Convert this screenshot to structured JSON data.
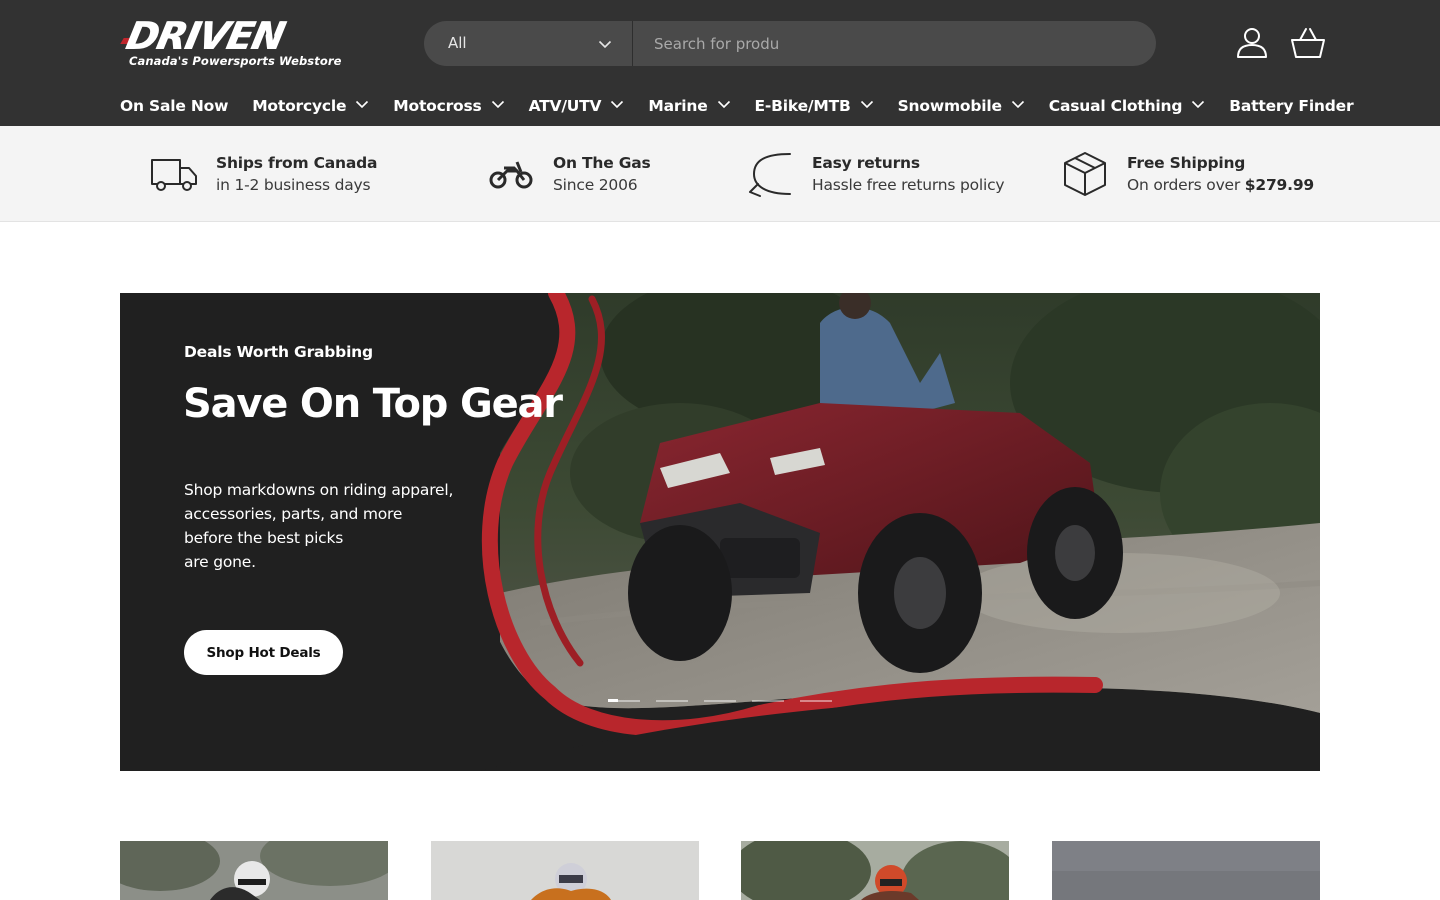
{
  "brand": {
    "logo_text": "DRIVEN",
    "tagline": "Canada's Powersports Webstore"
  },
  "search": {
    "category_selected": "All",
    "placeholder": "Search for produ"
  },
  "header_icons": [
    "account-icon",
    "basket-icon"
  ],
  "nav": {
    "items": [
      {
        "label": "On Sale Now",
        "has_dropdown": false
      },
      {
        "label": "Motorcycle",
        "has_dropdown": true
      },
      {
        "label": "Motocross",
        "has_dropdown": true
      },
      {
        "label": "ATV/UTV",
        "has_dropdown": true
      },
      {
        "label": "Marine",
        "has_dropdown": true
      },
      {
        "label": "E-Bike/MTB",
        "has_dropdown": true
      },
      {
        "label": "Snowmobile",
        "has_dropdown": true
      },
      {
        "label": "Casual Clothing",
        "has_dropdown": true
      },
      {
        "label": "Battery Finder",
        "has_dropdown": false
      }
    ]
  },
  "usp": [
    {
      "icon": "truck-icon",
      "title": "Ships from Canada",
      "subtitle": "in 1-2 business days"
    },
    {
      "icon": "motorbike-icon",
      "title": "On The Gas",
      "subtitle": "Since 2006"
    },
    {
      "icon": "return-arrow-icon",
      "title": "Easy returns",
      "subtitle": "Hassle free returns policy"
    },
    {
      "icon": "box-icon",
      "title": "Free Shipping",
      "subtitle_prefix": "On orders over",
      "subtitle_value": "$279.99"
    }
  ],
  "hero": {
    "eyebrow": "Deals Worth Grabbing",
    "title": "Save On Top Gear",
    "body": "Shop markdowns on riding apparel, accessories, parts, and more before the best picks are gone.",
    "body_lines": [
      "Shop markdowns on riding apparel,",
      "accessories, parts, and more",
      "before the best picks",
      "are gone."
    ],
    "cta": "Shop Hot Deals",
    "slides_total": 5,
    "slide_active": 1
  },
  "colors": {
    "header_bg": "#323232",
    "usp_bg": "#f4f4f4",
    "hero_bg": "#202020",
    "accent_red": "#b8262c"
  }
}
